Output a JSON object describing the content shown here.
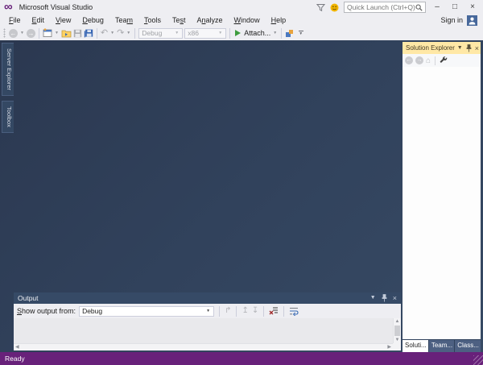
{
  "window": {
    "title": "Microsoft Visual Studio"
  },
  "titlebar": {
    "quick_launch_placeholder": "Quick Launch (Ctrl+Q)",
    "minimize_glyph": "–",
    "maximize_glyph": "□",
    "close_glyph": "×",
    "icons": [
      "vs-logo-icon",
      "notifications-funnel-icon",
      "feedback-smiley-icon",
      "search-icon"
    ]
  },
  "menubar": {
    "items": [
      {
        "label": "File",
        "mnemonic": 0
      },
      {
        "label": "Edit",
        "mnemonic": 0
      },
      {
        "label": "View",
        "mnemonic": 0
      },
      {
        "label": "Debug",
        "mnemonic": 0
      },
      {
        "label": "Team",
        "mnemonic": 3
      },
      {
        "label": "Tools",
        "mnemonic": 0
      },
      {
        "label": "Test",
        "mnemonic": 2
      },
      {
        "label": "Analyze",
        "mnemonic": 1
      },
      {
        "label": "Window",
        "mnemonic": 0
      },
      {
        "label": "Help",
        "mnemonic": 0
      }
    ],
    "sign_in": "Sign in"
  },
  "toolbar": {
    "configuration": "Debug",
    "platform": "x86",
    "attach_label": "Attach...",
    "icons": [
      "navigate-backward-icon",
      "navigate-forward-icon",
      "new-project-icon",
      "open-file-icon",
      "save-icon",
      "save-all-icon",
      "undo-icon",
      "redo-icon",
      "start-debug-play-icon",
      "toolbar-misc-icon",
      "toolbar-options-icon"
    ]
  },
  "left_tabs": [
    {
      "label": "Server Explorer"
    },
    {
      "label": "Toolbox"
    }
  ],
  "solution_explorer": {
    "title": "Solution Explorer",
    "toolbar_icons": [
      "back-icon",
      "forward-icon",
      "home-icon",
      "properties-wrench-icon"
    ],
    "tabs": [
      {
        "label": "Soluti..."
      },
      {
        "label": "Team..."
      },
      {
        "label": "Class..."
      }
    ]
  },
  "output": {
    "title": "Output",
    "show_output_from_label": "Show output from:",
    "show_output_from_mnemonic": 0,
    "selected_source": "Debug",
    "toolbar_icons": [
      "find-message-in-code-icon",
      "previous-message-icon",
      "next-message-icon",
      "clear-all-icon",
      "word-wrap-icon"
    ]
  },
  "statusbar": {
    "text": "Ready"
  },
  "colors": {
    "accent_purple": "#68217a",
    "active_title_gold": "#ffe8a6",
    "chrome_gray": "#eeeef2",
    "mdi_dark_blue": "#2b3850",
    "attach_green": "#3e9c3e"
  }
}
